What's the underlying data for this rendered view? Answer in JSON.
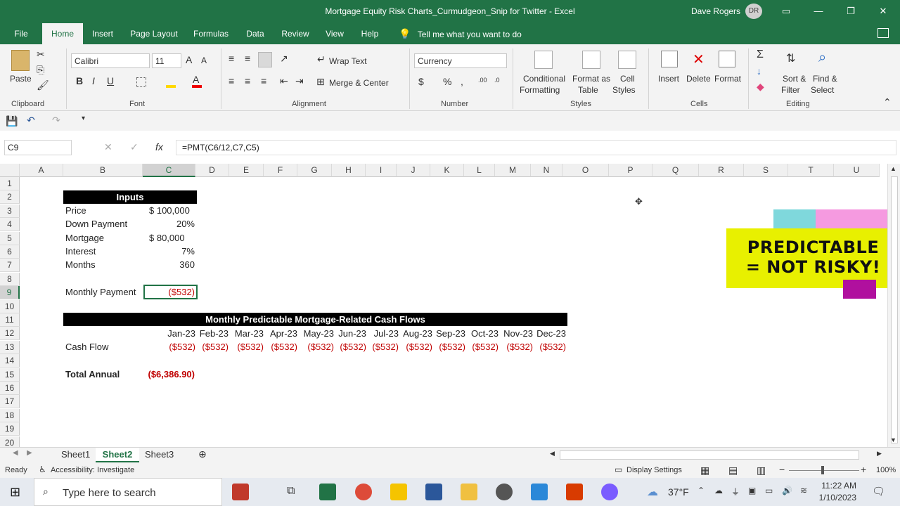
{
  "window": {
    "title": "Mortgage Equity Risk Charts_Curmudgeon_Snip for Twitter  -  Excel",
    "user": "Dave Rogers",
    "avatar": "DR"
  },
  "menu_tabs": [
    "File",
    "Home",
    "Insert",
    "Page Layout",
    "Formulas",
    "Data",
    "Review",
    "View",
    "Help"
  ],
  "active_tab": "Home",
  "tell_me": "Tell me what you want to do",
  "ribbon": {
    "paste": "Paste",
    "font_name": "Calibri",
    "font_size": "11",
    "wrap_text": "Wrap Text",
    "merge_center": "Merge & Center",
    "number_format": "Currency",
    "conditional_formatting_1": "Conditional",
    "conditional_formatting_2": "Formatting",
    "format_as_table_1": "Format as",
    "format_as_table_2": "Table",
    "cell_styles_1": "Cell",
    "cell_styles_2": "Styles",
    "insert": "Insert",
    "delete": "Delete",
    "format": "Format",
    "sort_filter_1": "Sort &",
    "sort_filter_2": "Filter",
    "find_select_1": "Find &",
    "find_select_2": "Select",
    "groups": [
      "Clipboard",
      "Font",
      "Alignment",
      "Number",
      "Styles",
      "Cells",
      "Editing"
    ]
  },
  "formula_bar": {
    "name_box": "C9",
    "formula": "=PMT(C6/12,C7,C5)"
  },
  "columns": [
    "A",
    "B",
    "C",
    "D",
    "E",
    "F",
    "G",
    "H",
    "I",
    "J",
    "K",
    "L",
    "M",
    "N",
    "O",
    "P",
    "Q",
    "R",
    "S",
    "T",
    "U"
  ],
  "rows": [
    "1",
    "2",
    "3",
    "4",
    "5",
    "6",
    "7",
    "8",
    "9",
    "10",
    "11",
    "12",
    "13",
    "14",
    "15",
    "16",
    "17",
    "18",
    "19",
    "20"
  ],
  "inputs": {
    "header": "Inputs",
    "items": [
      {
        "label": "Price",
        "value": "$  100,000"
      },
      {
        "label": "Down Payment",
        "value": "20%"
      },
      {
        "label": "Mortgage",
        "value": "$    80,000"
      },
      {
        "label": "Interest",
        "value": "7%"
      },
      {
        "label": "Months",
        "value": "360"
      }
    ],
    "monthly_payment_label": "Monthly Payment",
    "monthly_payment_value": "($532)"
  },
  "cash_flows": {
    "header": "Monthly Predictable Mortgage-Related Cash Flows",
    "months": [
      "Jan-23",
      "Feb-23",
      "Mar-23",
      "Apr-23",
      "May-23",
      "Jun-23",
      "Jul-23",
      "Aug-23",
      "Sep-23",
      "Oct-23",
      "Nov-23",
      "Dec-23"
    ],
    "row_label": "Cash Flow",
    "values": [
      "($532)",
      "($532)",
      "($532)",
      "($532)",
      "($532)",
      "($532)",
      "($532)",
      "($532)",
      "($532)",
      "($532)",
      "($532)",
      "($532)"
    ],
    "total_label": "Total Annual",
    "total_value": "($6,386.90)"
  },
  "sticker": {
    "line1": "PREDICTABLE",
    "line2": "= NOT RISKY!",
    "bg": "#e8f000",
    "teal": "#7fd8dc",
    "pink": "#f59ae0",
    "purple": "#b0109e"
  },
  "sheets": [
    "Sheet1",
    "Sheet2",
    "Sheet3"
  ],
  "active_sheet": "Sheet2",
  "status": {
    "ready": "Ready",
    "accessibility": "Accessibility: Investigate",
    "display_settings": "Display Settings",
    "zoom": "100%"
  },
  "taskbar": {
    "search_placeholder": "Type here to search",
    "weather": "37°F",
    "time": "11:22 AM",
    "date": "1/10/2023"
  },
  "colors": {
    "excel_green": "#217346",
    "negative_red": "#c00000"
  }
}
